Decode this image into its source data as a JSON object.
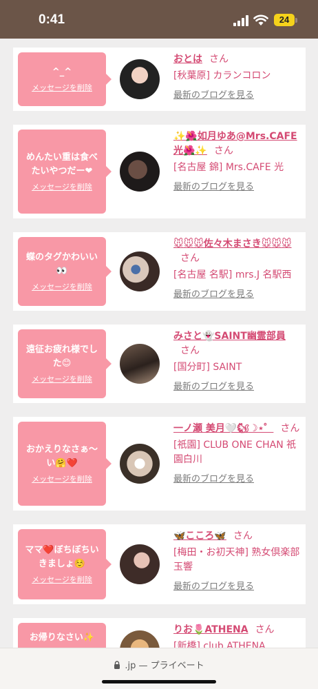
{
  "status_bar": {
    "time": "0:41",
    "battery": "24",
    "signal_icon": "cellular-signal-icon",
    "wifi_icon": "wifi-icon"
  },
  "colors": {
    "accent": "#d44a73",
    "bubble": "#f898a6",
    "status_bar": "#6b5548"
  },
  "cards": [
    {
      "message": "^_^",
      "delete_label": "メッセージを削除",
      "name": "おとは",
      "san": "さん",
      "shop": "[秋葉原] カランコロン",
      "blog_link": "最新のブログを見る"
    },
    {
      "message": "めんたい重は食べたいやつだー❤",
      "delete_label": "メッセージを削除",
      "name": "✨🌺如月ゆあ@Mrs.CAFE光🌺✨",
      "san": "さん",
      "shop": "[名古屋 錦] Mrs.CAFE 光",
      "blog_link": "最新のブログを見る"
    },
    {
      "message": "蝶のタグかわいい👀",
      "delete_label": "メッセージを削除",
      "name": "🐭🐭🐭佐々木まさき🐭🐭🐭",
      "san": "さん",
      "shop": "[名古屋 名駅] mrs.J 名駅西",
      "blog_link": "最新のブログを見る"
    },
    {
      "message": "遠征お疲れ様でした😊",
      "delete_label": "メッセージを削除",
      "name": "みさと👻SAINT幽霊部員",
      "san": "さん",
      "shop": "[国分町] SAINT",
      "blog_link": "最新のブログを見る"
    },
    {
      "message": "おかえりなさぁ〜い🤗❤️",
      "delete_label": "メッセージを削除",
      "name": "一ノ瀬 美月🤍🐿☽⋆゜",
      "san": "さん",
      "shop": "[祇園] CLUB ONE CHAN 祇園白川",
      "blog_link": "最新のブログを見る"
    },
    {
      "message": "ママ❤️ぼちぼちいきましょ☺️",
      "delete_label": "メッセージを削除",
      "name": "🦋こころ🦋",
      "san": "さん",
      "shop": "[梅田・お初天神] 熟女倶楽部 玉響",
      "blog_link": "最新のブログを見る"
    },
    {
      "message": "お帰りなさい✨",
      "delete_label": "",
      "name": "りお🌷ATHENA",
      "san": "さん",
      "shop": "[新橋] club ATHENA",
      "blog_link": ""
    }
  ],
  "bottom_bar": {
    "url": ".jp — プライベート",
    "lock_icon": "lock-icon"
  }
}
